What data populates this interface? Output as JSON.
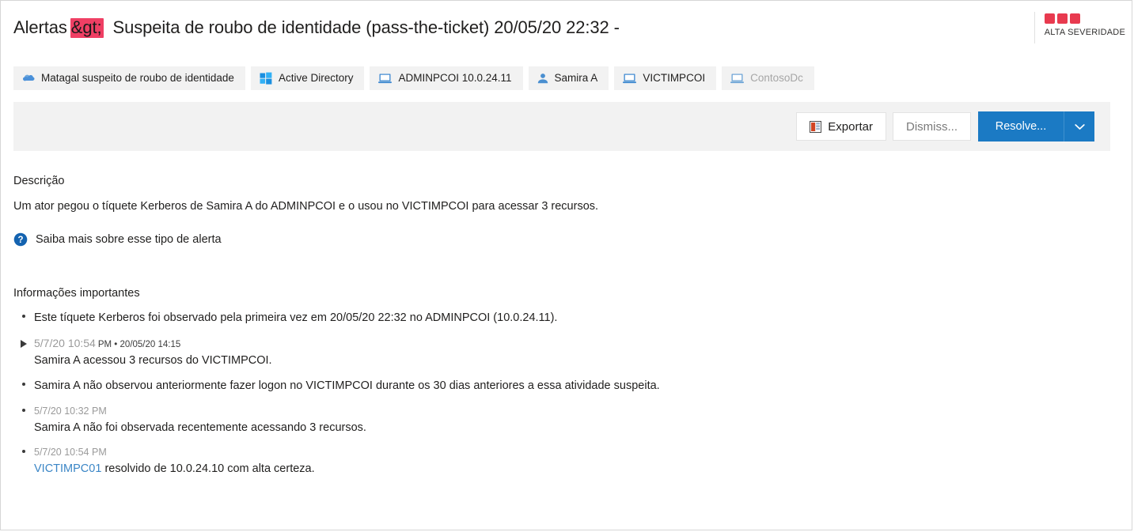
{
  "header": {
    "breadcrumb": "Alertas",
    "gt_entity": "&gt;",
    "alert_title": "Suspeita de roubo de identidade (pass-the-ticket) 20/05/20 22:32 -",
    "severity_label": "ALTA SEVERIDADE",
    "severity_color": "#e83a4f",
    "gt_highlight_color": "#ef3f64"
  },
  "chips": [
    {
      "icon": "bush-icon",
      "label": "Matagal suspeito de roubo de identidade",
      "muted": false
    },
    {
      "icon": "windows-icon",
      "label": "Active Directory",
      "muted": false
    },
    {
      "icon": "computer-icon",
      "label": "ADMINPCOI 10.0.24.11",
      "muted": false
    },
    {
      "icon": "person-icon",
      "label": "Samira A",
      "muted": false
    },
    {
      "icon": "computer-icon",
      "label": "VICTIMPCOI",
      "muted": false
    },
    {
      "icon": "computer-icon",
      "label": "ContosoDc",
      "muted": true
    }
  ],
  "toolbar": {
    "export_label": "Exportar",
    "export_icon": "excel-icon",
    "dismiss_label": "Dismiss...",
    "resolve_label": "Resolve...",
    "resolve_caret_icon": "chevron-down-icon",
    "resolve_color": "#1b7ac4"
  },
  "description": {
    "heading": "Descrição",
    "body": "Um ator pegou o tíquete Kerberos de Samira A do ADMINPCOI e o usou no VICTIMPCOI para acessar 3 recursos.",
    "learn_more": "Saiba mais sobre esse tipo de alerta",
    "learn_more_icon": "help-circle-icon"
  },
  "important_info": {
    "heading": "Informações importantes",
    "items": [
      {
        "marker": "dot",
        "timestamp_main": "",
        "timestamp_sub": "",
        "text": "Este tíquete Kerberos foi observado pela primeira vez em 20/05/20 22:32 no ADMINPCOI (10.0.24.11)."
      },
      {
        "marker": "arrow",
        "timestamp_main": "5/7/20 10:54",
        "timestamp_sub": "PM • 20/05/20 14:15",
        "text": "Samira A acessou 3 recursos do VICTIMPCOI."
      },
      {
        "marker": "dot",
        "timestamp_main": "",
        "timestamp_sub": "",
        "text": "Samira A não observou anteriormente fazer logon no VICTIMPCOI durante os 30 dias anteriores a essa atividade suspeita."
      },
      {
        "marker": "dot",
        "timestamp_small": "5/7/20 10:32 PM",
        "text": "Samira A não foi observada recentemente acessando 3 recursos."
      },
      {
        "marker": "dot",
        "timestamp_small": "5/7/20 10:54 PM",
        "link_text": "VICTIMPC01",
        "text": " resolvido de 10.0.24.10 com alta certeza."
      }
    ]
  }
}
